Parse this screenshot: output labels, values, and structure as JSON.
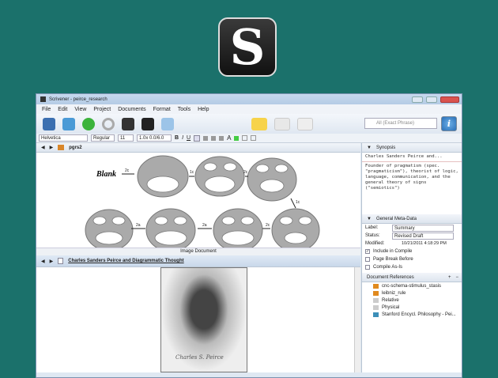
{
  "logo": {
    "letter": "S"
  },
  "window": {
    "title": "Scrivener - peirce_research"
  },
  "menu": [
    "File",
    "Edit",
    "View",
    "Project",
    "Documents",
    "Format",
    "Tools",
    "Help"
  ],
  "search": {
    "placeholder": "All (Exact Phrase)"
  },
  "info_label": "i",
  "format": {
    "font": "Helvetica",
    "style": "Regular",
    "size": "11",
    "spacing": "1.0x 0.0/6.0",
    "bold": "B",
    "italic": "I",
    "underline": "U"
  },
  "top_editor": {
    "doc_title": "pgrs2",
    "footer": "Image Document",
    "diagram": {
      "blank": "Blank",
      "arrows": [
        "2c",
        "1c",
        "2c",
        "1c",
        "2c",
        "2a",
        "2a"
      ]
    }
  },
  "bottom_editor": {
    "doc_title": "Charles Sanders Peirce and Diagrammatic Thought",
    "signature": "Charles S. Peirce"
  },
  "inspector": {
    "synopsis_header": "Synopsis",
    "synopsis_title": "Charles Sanders Peirce and...",
    "synopsis_text": "Founder of pragmatism (spec. \"pragmaticism\"), theorist of logic, language, communication, and the general theory of signs (\"semiotics\")",
    "meta_header": "General Meta-Data",
    "label_label": "Label:",
    "label_value": "Summary",
    "status_label": "Status:",
    "status_value": "Revised Draft",
    "modified_label": "Modified:",
    "modified_value": "10/21/2011 4:18:29 PM",
    "checks": [
      {
        "label": "Include in Compile",
        "checked": true
      },
      {
        "label": "Page Break Before",
        "checked": false
      },
      {
        "label": "Compile As-Is",
        "checked": false
      }
    ],
    "refs_header": "Document References",
    "refs": [
      {
        "label": "cnc-schema-stimulus_stasis",
        "color": "#e08a1e"
      },
      {
        "label": "leibniz_rule",
        "color": "#e08a1e"
      },
      {
        "label": "Relative",
        "color": "#ccc"
      },
      {
        "label": "Physical",
        "color": "#ccc"
      },
      {
        "label": "Stanford Encycl. Philosophy - Pei...",
        "color": "#3c8fb8"
      }
    ]
  }
}
